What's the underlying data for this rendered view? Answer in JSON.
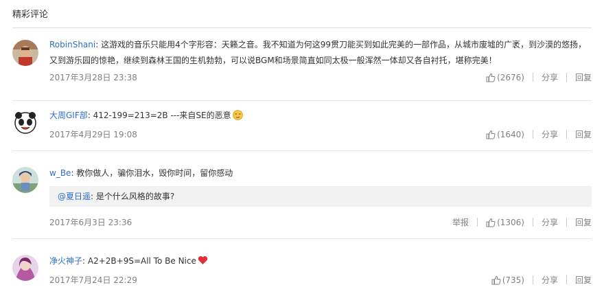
{
  "section": {
    "title": "精彩评论"
  },
  "comments": [
    {
      "user": "RobinShani",
      "sep": ": ",
      "text": "这游戏的音乐只能用4个字形容：天籁之音。我不知道为何这99贯刀能买到如此完美的一部作品，从城市废墟的广袤，到沙漠的悠扬，又到游乐园的惊艳，继续到森林王国的生机勃勃，可以说BGM和场景简直如同太极一般浑然一体却又各自衬托，堪称完美！",
      "date": "2017年3月28日 23:38",
      "likes": "(2676)",
      "share": "分享",
      "reply": "回复"
    },
    {
      "user": "大周GIF部",
      "sep": ": ",
      "text": "412-199=213=2B ---来自SE的恶意",
      "emoji": "smirk-emoji",
      "date": "2017年4月29日 19:08",
      "likes": "(1640)",
      "share": "分享",
      "reply": "回复"
    },
    {
      "user": "w_Be",
      "sep": ": ",
      "text": "教你做人，骗你泪水，毁你时间，留你感动",
      "quote_user": "@夏日遥",
      "quote_text": ": 是个什么风格的故事?",
      "date": "2017年6月3日 23:36",
      "report": "举报",
      "likes": "(1306)",
      "share": "分享",
      "reply": "回复"
    },
    {
      "user": "净火神子",
      "sep": ": ",
      "text": "A2+2B+9S=All To Be Nice",
      "emoji": "heart-emoji",
      "date": "2017年7月24日 22:29",
      "likes": "(735)",
      "share": "分享",
      "reply": "回复"
    }
  ],
  "colors": {
    "link": "#2e6ec8",
    "meta": "#808080",
    "quote_bg": "#f2f2f2"
  }
}
